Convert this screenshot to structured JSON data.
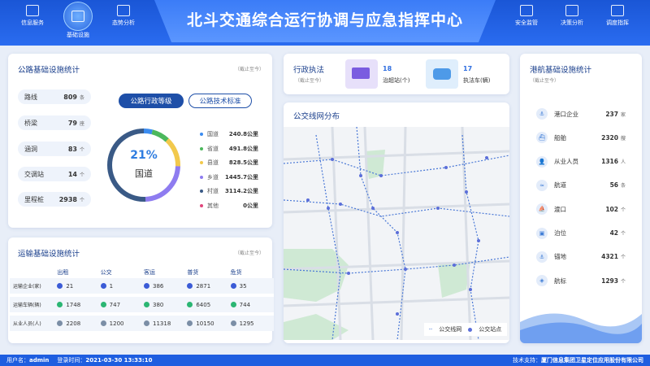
{
  "header": {
    "title": "北斗交通综合运行协调与应急指挥中心",
    "nav_left": [
      {
        "label": "信息服务"
      },
      {
        "label": "基础设施"
      },
      {
        "label": "态势分析"
      }
    ],
    "nav_right": [
      {
        "label": "安全监管"
      },
      {
        "label": "决策分析"
      },
      {
        "label": "调度指挥"
      }
    ]
  },
  "highway": {
    "title": "公路基础设施统计",
    "since": "（截止至今）",
    "stats": [
      {
        "label": "路线",
        "value": "809",
        "unit": "条"
      },
      {
        "label": "桥梁",
        "value": "79",
        "unit": "座"
      },
      {
        "label": "涵洞",
        "value": "83",
        "unit": "个"
      },
      {
        "label": "交调站",
        "value": "14",
        "unit": "个"
      },
      {
        "label": "里程桩",
        "value": "2938",
        "unit": "个"
      }
    ],
    "tab_active": "公路行政等级",
    "tab_inactive": "公路技术标准",
    "donut_percent": "21%",
    "donut_label": "国道",
    "legend": [
      {
        "name": "国道",
        "value": "240.8公里",
        "color": "#3b8cf0"
      },
      {
        "name": "省道",
        "value": "491.8公里",
        "color": "#4cb85c"
      },
      {
        "name": "县道",
        "value": "828.5公里",
        "color": "#f2c94c"
      },
      {
        "name": "乡道",
        "value": "1445.7公里",
        "color": "#8e7cf0"
      },
      {
        "name": "村道",
        "value": "3114.2公里",
        "color": "#3a5a86"
      },
      {
        "name": "其他",
        "value": "0公里",
        "color": "#e0457b"
      }
    ]
  },
  "chart_data": {
    "type": "pie",
    "categories": [
      "国道",
      "省道",
      "县道",
      "乡道",
      "村道",
      "其他"
    ],
    "values": [
      240.8,
      491.8,
      828.5,
      1445.7,
      3114.2,
      0
    ]
  },
  "enforcement": {
    "title": "行政执法",
    "since": "（截止至今）",
    "items": [
      {
        "value": "18",
        "label": "治超站(个)"
      },
      {
        "value": "17",
        "label": "执法车(辆)"
      }
    ]
  },
  "busmap": {
    "title": "公交线网分布",
    "legend_line": "公交线网",
    "legend_stop": "公交站点"
  },
  "transport": {
    "title": "运输基础设施统计",
    "since": "（截止至今）",
    "columns": [
      "",
      "出租",
      "公交",
      "客运",
      "普货",
      "危货"
    ],
    "rows": [
      {
        "label": "运输企业(家)",
        "cells": [
          "21",
          "1",
          "386",
          "2871",
          "35"
        ]
      },
      {
        "label": "运输车辆(辆)",
        "cells": [
          "1748",
          "747",
          "380",
          "6405",
          "744"
        ]
      },
      {
        "label": "从业人员(人)",
        "cells": [
          "2208",
          "1200",
          "11318",
          "10150",
          "1295"
        ]
      }
    ]
  },
  "port": {
    "title": "港航基础设施统计",
    "since": "（截止至今）",
    "items": [
      {
        "label": "港口企业",
        "value": "237",
        "unit": "家"
      },
      {
        "label": "船舶",
        "value": "2320",
        "unit": "艘"
      },
      {
        "label": "从业人员",
        "value": "1316",
        "unit": "人"
      },
      {
        "label": "航道",
        "value": "56",
        "unit": "条"
      },
      {
        "label": "渡口",
        "value": "102",
        "unit": "个"
      },
      {
        "label": "泊位",
        "value": "42",
        "unit": "个"
      },
      {
        "label": "锚地",
        "value": "4321",
        "unit": "个"
      },
      {
        "label": "航标",
        "value": "1293",
        "unit": "个"
      }
    ]
  },
  "footer": {
    "user_label": "用户名：",
    "user": "admin",
    "login_label": "登录时间：",
    "login_time": "2021-03-30  13:33:10",
    "support_label": "技术支持：",
    "support": "厦门信息集团卫星定位应用股份有限公司"
  }
}
